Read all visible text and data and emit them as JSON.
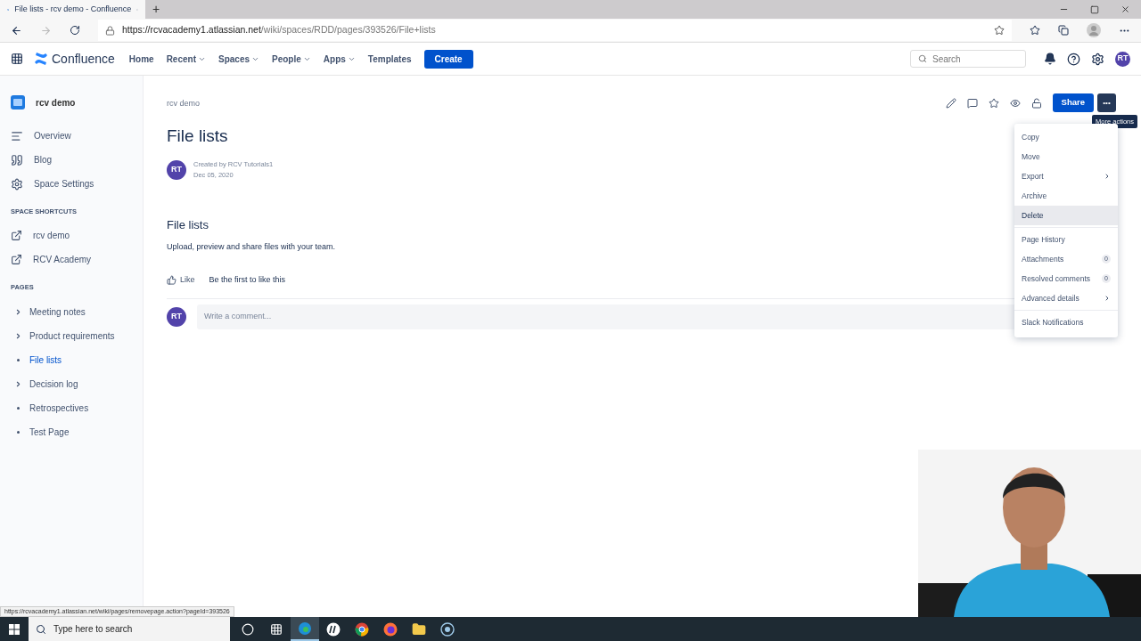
{
  "browser": {
    "tab_title": "File lists - rcv demo - Confluence",
    "new_tab": "+",
    "url_host": "https://rcvacademy1.atlassian.net",
    "url_path": "/wiki/spaces/RDD/pages/393526/File+lists"
  },
  "topnav": {
    "product": "Confluence",
    "items": [
      {
        "label": "Home",
        "dropdown": false
      },
      {
        "label": "Recent",
        "dropdown": true
      },
      {
        "label": "Spaces",
        "dropdown": true
      },
      {
        "label": "People",
        "dropdown": true
      },
      {
        "label": "Apps",
        "dropdown": true
      },
      {
        "label": "Templates",
        "dropdown": false
      }
    ],
    "create": "Create",
    "search_placeholder": "Search",
    "avatar": "RT"
  },
  "sidebar": {
    "space": "rcv demo",
    "links": [
      {
        "label": "Overview",
        "kind": "overview"
      },
      {
        "label": "Blog",
        "kind": "blog"
      },
      {
        "label": "Space Settings",
        "kind": "settings"
      }
    ],
    "shortcuts_heading": "SPACE SHORTCUTS",
    "shortcuts": [
      "rcv demo",
      "RCV Academy"
    ],
    "pages_heading": "PAGES",
    "pages": [
      {
        "label": "Meeting notes",
        "has_children": true,
        "selected": false
      },
      {
        "label": "Product requirements",
        "has_children": true,
        "selected": false
      },
      {
        "label": "File lists",
        "has_children": false,
        "selected": true
      },
      {
        "label": "Decision log",
        "has_children": true,
        "selected": false
      },
      {
        "label": "Retrospectives",
        "has_children": false,
        "selected": false
      },
      {
        "label": "Test Page",
        "has_children": false,
        "selected": false
      }
    ]
  },
  "page": {
    "breadcrumb": "rcv demo",
    "title": "File lists",
    "author_avatar": "RT",
    "created_by": "Created by RCV Tutorials1",
    "date": "Dec 05, 2020",
    "heading": "File lists",
    "body": "Upload, preview and share files with your team.",
    "like": "Like",
    "like_note": "Be the first to like this",
    "comment_avatar": "RT",
    "comment_placeholder": "Write a comment..."
  },
  "toolbar": {
    "share": "Share",
    "more": "•••",
    "tooltip": "More actions"
  },
  "menu": {
    "groups": [
      [
        {
          "label": "Copy",
          "kind": "item",
          "selected": false
        },
        {
          "label": "Move",
          "kind": "item",
          "selected": false
        },
        {
          "label": "Export",
          "kind": "submenu",
          "selected": false
        },
        {
          "label": "Archive",
          "kind": "item",
          "selected": false
        },
        {
          "label": "Delete",
          "kind": "item",
          "selected": true
        }
      ],
      [
        {
          "label": "Page History",
          "kind": "item",
          "selected": false
        },
        {
          "label": "Attachments",
          "kind": "count",
          "count": "0",
          "selected": false
        },
        {
          "label": "Resolved comments",
          "kind": "count",
          "count": "0",
          "selected": false
        },
        {
          "label": "Advanced details",
          "kind": "submenu",
          "selected": false
        }
      ],
      [
        {
          "label": "Slack Notifications",
          "kind": "item",
          "selected": false
        }
      ]
    ]
  },
  "status_url": "https://rcvacademy1.atlassian.net/wiki/pages/removepage.action?pageId=393526",
  "taskbar": {
    "search_placeholder": "Type here to search",
    "apps": [
      {
        "kind": "cortana",
        "active": false
      },
      {
        "kind": "taskview",
        "active": false
      },
      {
        "kind": "edge",
        "active": true
      },
      {
        "kind": "hp",
        "active": false
      },
      {
        "kind": "chrome",
        "active": false
      },
      {
        "kind": "firefox",
        "active": false
      },
      {
        "kind": "folder",
        "active": false
      },
      {
        "kind": "recorder",
        "active": false
      }
    ]
  }
}
